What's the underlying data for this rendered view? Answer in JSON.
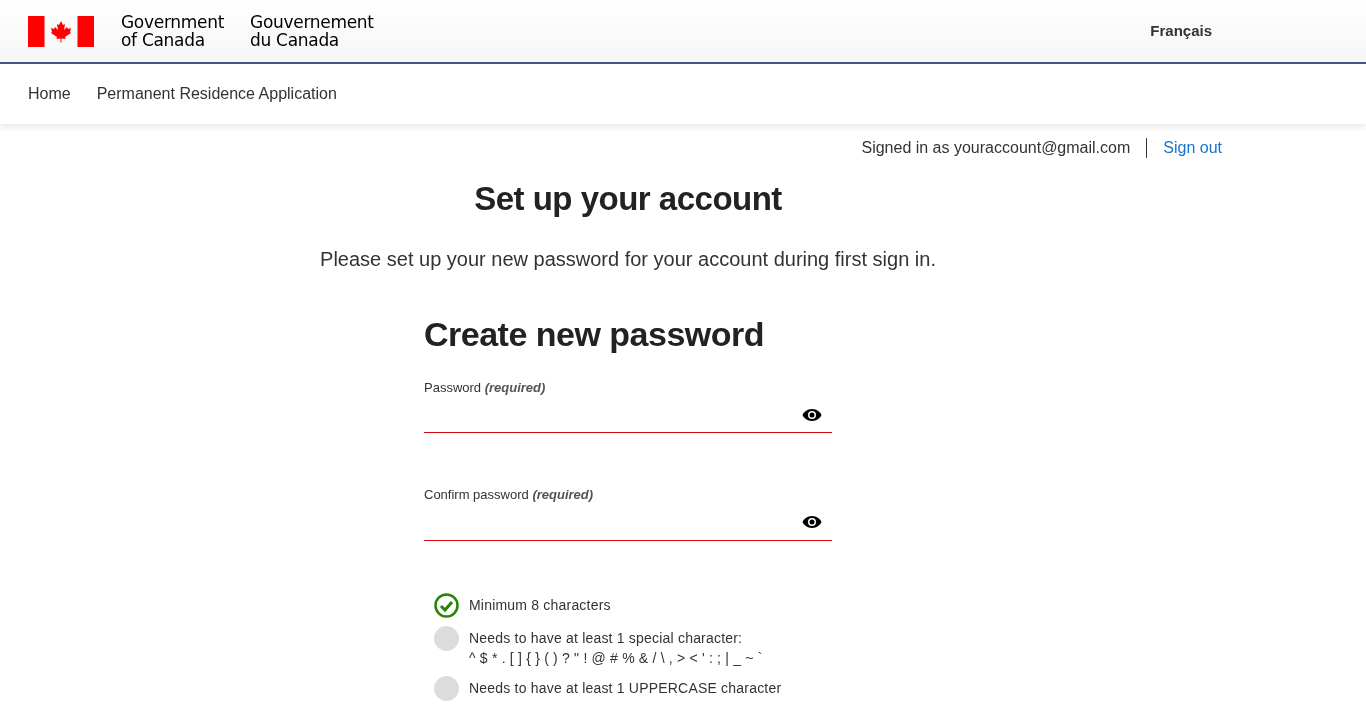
{
  "header": {
    "name_en_1": "Government",
    "name_en_2": "of Canada",
    "name_fr_1": "Gouvernement",
    "name_fr_2": "du Canada",
    "language_link": "Français"
  },
  "breadcrumbs": [
    {
      "label": "Home"
    },
    {
      "label": "Permanent Residence Application"
    }
  ],
  "account": {
    "signed_in": "Signed in as youraccount@gmail.com",
    "sign_out": "Sign out"
  },
  "page_title": "Set up your account",
  "intro": "Please set up your new password for your account during first sign in.",
  "form": {
    "title": "Create new password",
    "fields": [
      {
        "label": "Password",
        "required": "(required)",
        "invalid": true
      },
      {
        "label": "Confirm password",
        "required": "(required)",
        "invalid": true
      }
    ],
    "rules": [
      {
        "text": "Minimum 8 characters",
        "met": true
      },
      {
        "text": "Needs to have at least 1 special character:",
        "detail": "^ $ * . [ ] { } ( ) ? \" ! @ # % & / \\ , > < ' : ; | _ ~ `",
        "met": false
      },
      {
        "text": "Needs to have at least 1 UPPERCASE character",
        "met": false
      }
    ]
  }
}
